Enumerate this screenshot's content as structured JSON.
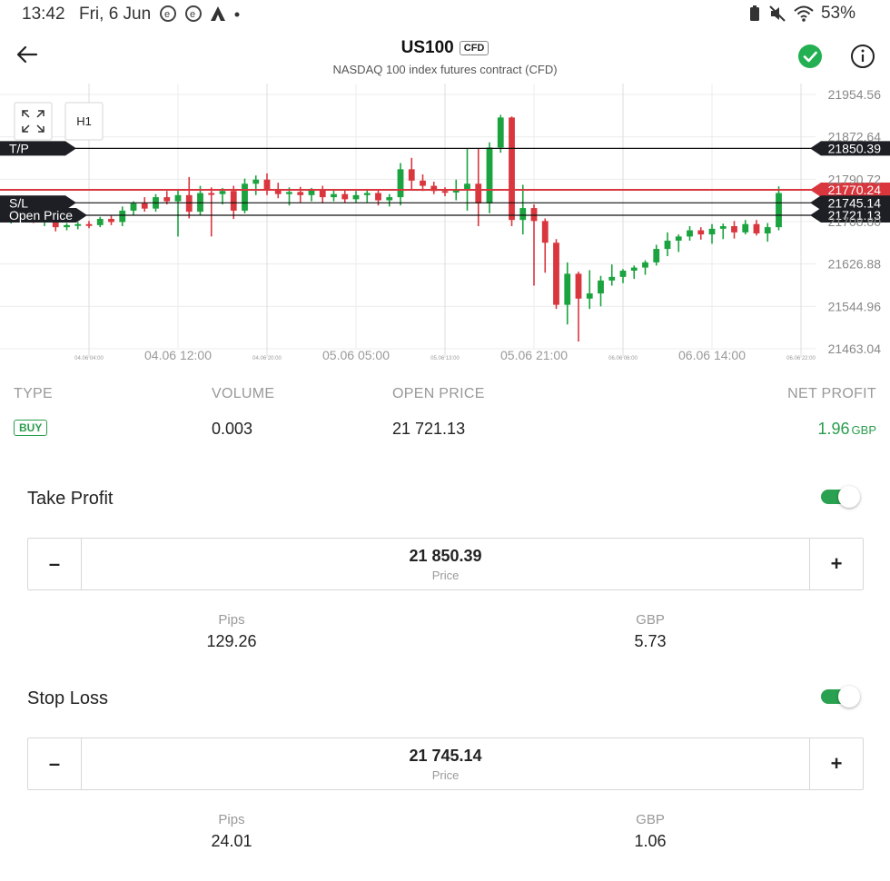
{
  "status_bar": {
    "time": "13:42",
    "date": "Fri, 6 Jun",
    "battery": "53%"
  },
  "header": {
    "title": "US100",
    "badge": "CFD",
    "subtitle": "NASDAQ 100 index futures contract (CFD)"
  },
  "chart_data": {
    "type": "candlestick",
    "timeframe": "H1",
    "y_ticks": [
      "21954.56",
      "21872.64",
      "21790.72",
      "21708.80",
      "21626.88",
      "21544.96",
      "21463.04"
    ],
    "y_ticks_values": [
      21954.56,
      21872.64,
      21790.72,
      21708.8,
      21626.88,
      21544.96,
      21463.04
    ],
    "ylim": [
      21463.04,
      21954.56
    ],
    "x_labels": [
      "04.06 12:00",
      "05.06 05:00",
      "05.06 21:00",
      "06.06 14:00"
    ],
    "x_small_labels": [
      "04.06 04:00",
      "04.06 20:00",
      "05.06 13:00",
      "06.06 06:00",
      "06.06 22:00"
    ],
    "lines": [
      {
        "name": "T/P",
        "value": 21850.39,
        "label": "21850.39",
        "color": "#111111"
      },
      {
        "name": "",
        "value": 21770.24,
        "label": "21770.24",
        "color": "#d9363e"
      },
      {
        "name": "S/L",
        "value": 21745.14,
        "label": "21745.14",
        "color": "#111111"
      },
      {
        "name": "Open Price",
        "value": 21721.13,
        "label": "21721.13",
        "color": "#111111"
      }
    ],
    "candles": [
      [
        21720,
        21732,
        21705,
        21725
      ],
      [
        21725,
        21742,
        21712,
        21730
      ],
      [
        21730,
        21735,
        21706,
        21712
      ],
      [
        21712,
        21724,
        21700,
        21716
      ],
      [
        21716,
        21720,
        21690,
        21698
      ],
      [
        21698,
        21706,
        21692,
        21702
      ],
      [
        21702,
        21708,
        21694,
        21704
      ],
      [
        21704,
        21710,
        21696,
        21702
      ],
      [
        21702,
        21718,
        21698,
        21714
      ],
      [
        21714,
        21722,
        21702,
        21708
      ],
      [
        21708,
        21738,
        21700,
        21730
      ],
      [
        21730,
        21748,
        21722,
        21744
      ],
      [
        21744,
        21756,
        21728,
        21734
      ],
      [
        21734,
        21762,
        21728,
        21756
      ],
      [
        21756,
        21768,
        21742,
        21748
      ],
      [
        21748,
        21770,
        21680,
        21760
      ],
      [
        21760,
        21795,
        21715,
        21728
      ],
      [
        21728,
        21778,
        21722,
        21764
      ],
      [
        21764,
        21775,
        21680,
        21762
      ],
      [
        21762,
        21774,
        21742,
        21768
      ],
      [
        21768,
        21778,
        21714,
        21730
      ],
      [
        21730,
        21792,
        21725,
        21782
      ],
      [
        21782,
        21798,
        21760,
        21790
      ],
      [
        21790,
        21802,
        21760,
        21772
      ],
      [
        21772,
        21784,
        21754,
        21762
      ],
      [
        21762,
        21775,
        21740,
        21766
      ],
      [
        21766,
        21776,
        21746,
        21760
      ],
      [
        21760,
        21774,
        21748,
        21770
      ],
      [
        21770,
        21778,
        21744,
        21756
      ],
      [
        21756,
        21772,
        21748,
        21762
      ],
      [
        21762,
        21770,
        21745,
        21752
      ],
      [
        21752,
        21768,
        21746,
        21760
      ],
      [
        21760,
        21770,
        21746,
        21764
      ],
      [
        21764,
        21772,
        21740,
        21750
      ],
      [
        21750,
        21762,
        21738,
        21756
      ],
      [
        21756,
        21822,
        21740,
        21810
      ],
      [
        21810,
        21832,
        21772,
        21788
      ],
      [
        21788,
        21800,
        21768,
        21778
      ],
      [
        21778,
        21786,
        21762,
        21768
      ],
      [
        21768,
        21775,
        21758,
        21765
      ],
      [
        21765,
        21790,
        21750,
        21772
      ],
      [
        21772,
        21850,
        21730,
        21782
      ],
      [
        21782,
        21850,
        21700,
        21744
      ],
      [
        21744,
        21862,
        21725,
        21852
      ],
      [
        21852,
        21915,
        21842,
        21910
      ],
      [
        21910,
        21912,
        21700,
        21712
      ],
      [
        21712,
        21780,
        21684,
        21735
      ],
      [
        21735,
        21742,
        21585,
        21710
      ],
      [
        21710,
        21715,
        21610,
        21668
      ],
      [
        21668,
        21675,
        21540,
        21548
      ],
      [
        21548,
        21630,
        21510,
        21608
      ],
      [
        21608,
        21612,
        21477,
        21560
      ],
      [
        21560,
        21615,
        21540,
        21570
      ],
      [
        21570,
        21604,
        21545,
        21595
      ],
      [
        21595,
        21626,
        21585,
        21602
      ],
      [
        21602,
        21617,
        21590,
        21614
      ],
      [
        21614,
        21624,
        21598,
        21620
      ],
      [
        21620,
        21634,
        21606,
        21630
      ],
      [
        21630,
        21664,
        21624,
        21656
      ],
      [
        21656,
        21688,
        21642,
        21672
      ],
      [
        21672,
        21684,
        21650,
        21680
      ],
      [
        21680,
        21700,
        21672,
        21692
      ],
      [
        21692,
        21698,
        21674,
        21684
      ],
      [
        21684,
        21704,
        21666,
        21695
      ],
      [
        21695,
        21705,
        21675,
        21700
      ],
      [
        21700,
        21710,
        21676,
        21688
      ],
      [
        21688,
        21712,
        21684,
        21704
      ],
      [
        21704,
        21712,
        21682,
        21686
      ],
      [
        21686,
        21706,
        21670,
        21698
      ],
      [
        21698,
        21777,
        21692,
        21764
      ]
    ]
  },
  "position": {
    "type_label": "TYPE",
    "type_value": "BUY",
    "volume_label": "VOLUME",
    "volume_value": "0.003",
    "open_label": "OPEN PRICE",
    "open_value": "21 721.13",
    "profit_label": "NET PROFIT",
    "profit_value": "1.96",
    "profit_currency": "GBP"
  },
  "take_profit": {
    "title": "Take Profit",
    "enabled": true,
    "minus": "–",
    "plus": "+",
    "value": "21 850.39",
    "value_label": "Price",
    "pips_label": "Pips",
    "pips": "129.26",
    "gbp_label": "GBP",
    "gbp": "5.73"
  },
  "stop_loss": {
    "title": "Stop Loss",
    "enabled": true,
    "minus": "–",
    "plus": "+",
    "value": "21 745.14",
    "value_label": "Price",
    "pips_label": "Pips",
    "pips": "24.01",
    "gbp_label": "GBP",
    "gbp": "1.06"
  },
  "colors": {
    "up": "#1aa33e",
    "down": "#d9363e",
    "accent_green": "#2a9d4d",
    "toggle": "#2aa150",
    "check": "#22b053"
  },
  "icons": [
    "back-arrow-icon",
    "check-circle-icon",
    "info-icon",
    "fullscreen-icon",
    "wifi-icon",
    "mute-icon",
    "battery-icon"
  ]
}
